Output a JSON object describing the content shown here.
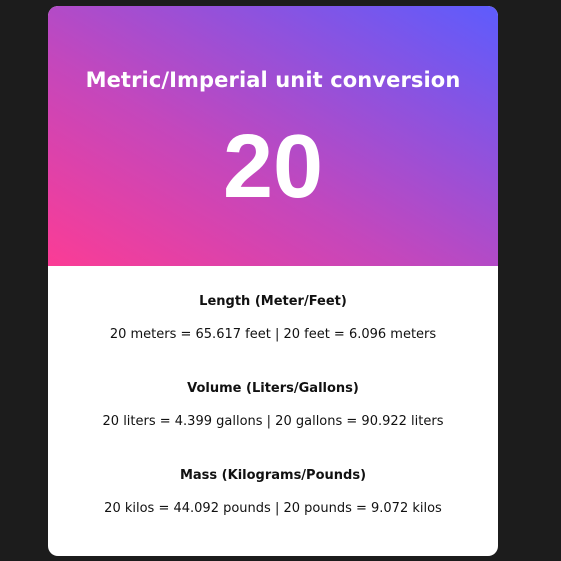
{
  "header": {
    "title": "Metric/Imperial unit conversion",
    "number": "20"
  },
  "sections": [
    {
      "title": "Length (Meter/Feet)",
      "text": "20 meters = 65.617 feet | 20 feet = 6.096 meters"
    },
    {
      "title": "Volume (Liters/Gallons)",
      "text": "20 liters = 4.399 gallons | 20 gallons = 90.922 liters"
    },
    {
      "title": "Mass (Kilograms/Pounds)",
      "text": "20 kilos = 44.092 pounds | 20 pounds = 9.072 kilos"
    }
  ],
  "colors": {
    "background": "#1c1c1c",
    "gradient_start": "#fb3c95",
    "gradient_end": "#5d5cfd"
  }
}
